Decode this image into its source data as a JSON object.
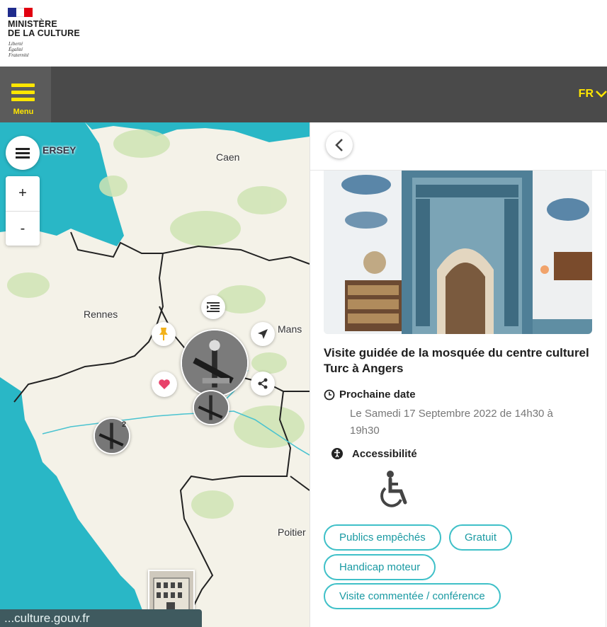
{
  "header": {
    "ministry_line1": "MINISTÈRE",
    "ministry_line2": "DE LA CULTURE",
    "motto1": "Liberté",
    "motto2": "Égalité",
    "motto3": "Fraternité"
  },
  "topbar": {
    "menu_label": "Menu",
    "lang": "FR",
    "accent_color": "#ffe600"
  },
  "map": {
    "places": {
      "jersey": "ERSEY",
      "caen": "Caen",
      "rennes": "Rennes",
      "mans": "Mans",
      "poitiers": "Poitier"
    },
    "zoom_in": "+",
    "zoom_out": "-",
    "cluster_small_count": "2",
    "url_text": "...culture.gouv.fr",
    "sea_color": "#29b7c6"
  },
  "panel": {
    "event_title": "Visite guidée de la mosquée du centre culturel Turc à Angers",
    "next_date_label": "Prochaine date",
    "next_date_value": "Le Samedi 17 Septembre 2022 de 14h30 à 19h30",
    "accessibility_label": "Accessibilité",
    "tags": [
      "Publics empêchés",
      "Gratuit",
      "Handicap moteur",
      "Visite commentée / conférence"
    ],
    "tag_color": "#3fc0c8"
  }
}
